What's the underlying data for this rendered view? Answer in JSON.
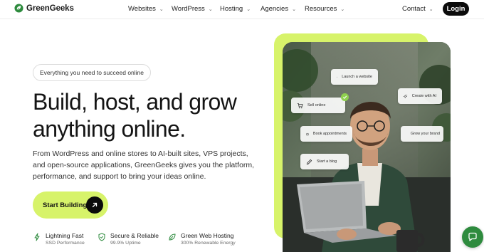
{
  "brand": {
    "name": "GreenGeeks",
    "registered_mark": "®"
  },
  "nav": {
    "items": [
      {
        "label": "Websites"
      },
      {
        "label": "WordPress"
      },
      {
        "label": "Hosting"
      },
      {
        "label": "Agencies"
      },
      {
        "label": "Resources"
      }
    ],
    "contact_label": "Contact",
    "login_label": "Login"
  },
  "hero": {
    "badge": "Everything you need to succeed online",
    "headline_line1": "Build, host, and grow",
    "headline_line2": "anything online.",
    "description": "From WordPress and online stores to AI-built sites, VPS projects, and open-source applications, GreenGeeks gives you the platform, performance, and support to bring your ideas online.",
    "cta_label": "Start Building"
  },
  "features": [
    {
      "title": "Lightning Fast",
      "subtitle": "SSD Performance",
      "icon": "lightning-icon"
    },
    {
      "title": "Secure & Reliable",
      "subtitle": "99.9% Uptime",
      "icon": "shield-check-icon"
    },
    {
      "title": "Green Web Hosting",
      "subtitle": "300% Renewable Energy",
      "icon": "leaf-icon"
    }
  ],
  "chips": [
    {
      "label": "Launch a website",
      "icon": "monitor-icon"
    },
    {
      "label": "Sell online",
      "icon": "cart-icon"
    },
    {
      "label": "Create with AI",
      "icon": "sparkle-icon"
    },
    {
      "label": "Book appointments",
      "icon": "calendar-icon"
    },
    {
      "label": "Grow your brand",
      "icon": "target-icon"
    },
    {
      "label": "Start a blog",
      "icon": "pencil-icon"
    }
  ],
  "colors": {
    "accent": "#d7f36a",
    "brand_green": "#2e8b3e",
    "dark": "#0b0b0b"
  },
  "icons": {
    "chat": "chat-bubble-icon",
    "cta_arrow": "arrow-up-right-icon"
  }
}
